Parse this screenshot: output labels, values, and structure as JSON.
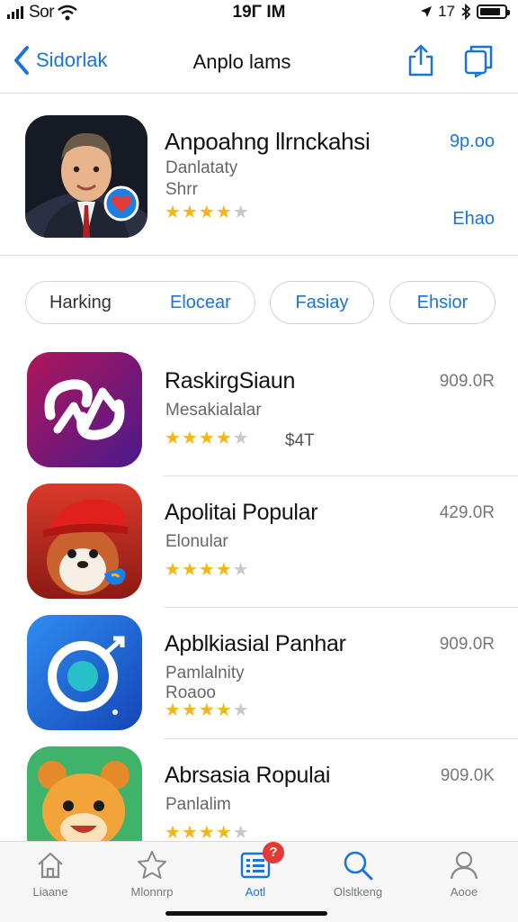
{
  "status_bar": {
    "carrier": "Sor",
    "time": "19Γ IM",
    "right_text": "17"
  },
  "navbar": {
    "back_label": "Sidorlak",
    "title": "Anplo lams"
  },
  "featured": {
    "title": "Anpoahng llrnckahsi",
    "subtitle_1": "Danlataty",
    "subtitle_2": "Shrr",
    "price": "9p.oo",
    "action": "Ehao",
    "rating": 4
  },
  "filters": {
    "group_left": "Harking",
    "group_right": "Elocear",
    "pill_1": "Fasiay",
    "pill_2": "Ehsior"
  },
  "apps": [
    {
      "name": "RaskirgSiaun",
      "subtitle_1": "Mesakialalar",
      "subtitle_2": "",
      "extra": "$4T",
      "price": "909.0R",
      "rating": 4
    },
    {
      "name": "Apolitai Popular",
      "subtitle_1": "Elonular",
      "subtitle_2": "",
      "extra": "",
      "price": "429.0R",
      "rating": 4
    },
    {
      "name": "Apblkiasial Panhar",
      "subtitle_1": "Pamlalnity",
      "subtitle_2": "Roaoo",
      "extra": "",
      "price": "909.0R",
      "rating": 4
    },
    {
      "name": "Abrsasia Ropulai",
      "subtitle_1": "Panlalim",
      "subtitle_2": "",
      "extra": "",
      "price": "909.0K",
      "rating": 4
    }
  ],
  "tabs": [
    {
      "label": "Liaane",
      "icon": "home-icon"
    },
    {
      "label": "Mlonnrp",
      "icon": "star-icon"
    },
    {
      "label": "Aotl",
      "icon": "list-icon",
      "badge": "?"
    },
    {
      "label": "Olsltkeng",
      "icon": "search-icon"
    },
    {
      "label": "Aooe",
      "icon": "person-icon"
    }
  ],
  "colors": {
    "accent": "#1a73d9",
    "star": "#f3b51a",
    "badge": "#e53935"
  }
}
